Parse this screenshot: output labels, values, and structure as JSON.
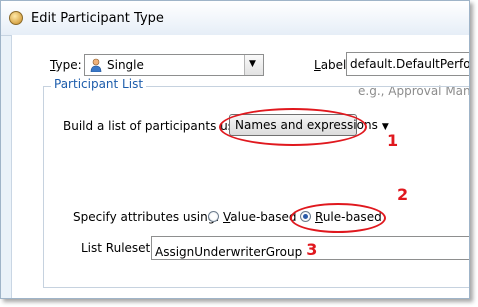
{
  "window": {
    "title": "Edit Participant Type"
  },
  "type_field": {
    "label": "Type:",
    "value": "Single",
    "icon": "person-icon"
  },
  "label_field": {
    "label": "Label:",
    "value": "default.DefaultPerformer",
    "hint": "e.g., Approval Manager"
  },
  "participant_list": {
    "legend": "Participant List",
    "build_label": "Build a list of participants using:",
    "build_value": "Names and expressions",
    "specify_label": "Specify attributes using:",
    "value_based_label": "Value-based",
    "rule_based_label": "Rule-based",
    "selected": "Rule-based",
    "ruleset_label": "List Ruleset:",
    "ruleset_value": "AssignUnderwriterGroup"
  },
  "annotations": {
    "n1": "1",
    "n2": "2",
    "n3": "3"
  },
  "colors": {
    "annotation": "#e0181e",
    "legend": "#1c5cab",
    "hint": "#8c8c8c"
  }
}
